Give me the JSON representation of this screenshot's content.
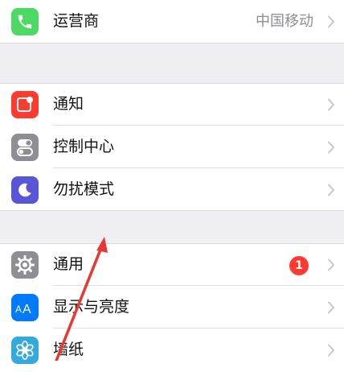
{
  "groups": [
    {
      "rows": [
        {
          "label": "运营商",
          "value": "中国移动",
          "icon": "phone-icon",
          "icon_color": "#4cd964"
        }
      ]
    },
    {
      "rows": [
        {
          "label": "通知",
          "icon": "notifications-icon",
          "icon_color": "#ff3b30"
        },
        {
          "label": "控制中心",
          "icon": "control-center-icon",
          "icon_color": "#8e8e93"
        },
        {
          "label": "勿扰模式",
          "icon": "moon-icon",
          "icon_color": "#5856d6"
        }
      ]
    },
    {
      "rows": [
        {
          "label": "通用",
          "badge": "1",
          "icon": "gear-icon",
          "icon_color": "#8e8e93"
        },
        {
          "label": "显示与亮度",
          "icon": "display-brightness-icon",
          "icon_color": "#007aff"
        },
        {
          "label": "墙纸",
          "icon": "wallpaper-flower-icon",
          "icon_color": "#34aadc"
        }
      ]
    }
  ],
  "annotation": {
    "color": "#e53935",
    "icon": "red-annotation-arrow"
  }
}
